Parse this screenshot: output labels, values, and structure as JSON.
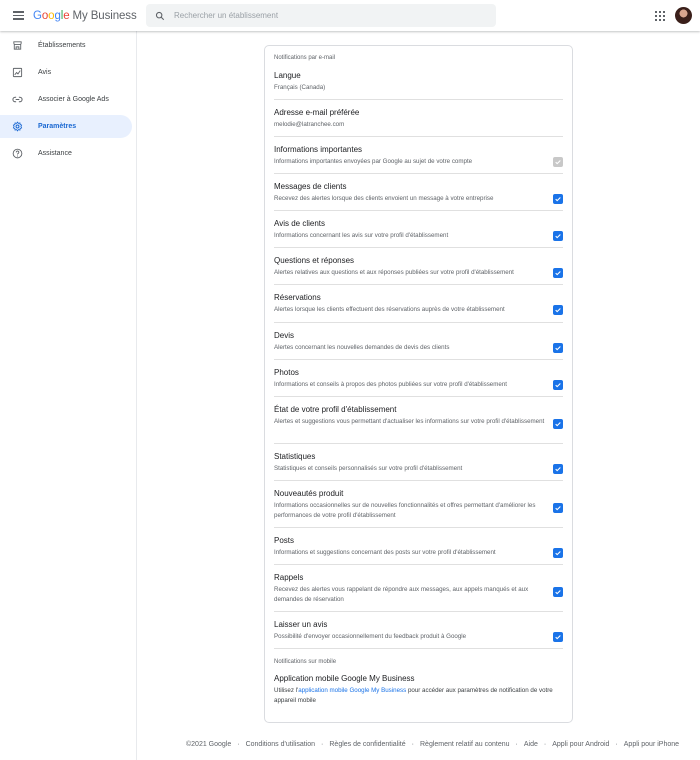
{
  "header": {
    "logo": {
      "g1": "G",
      "g2": "o",
      "g3": "o",
      "g4": "g",
      "g5": "l",
      "g6": "e",
      "product": "My Business"
    },
    "search_placeholder": "Rechercher un établissement"
  },
  "sidebar": {
    "items": [
      {
        "label": "Établissements",
        "icon": "storefront-icon"
      },
      {
        "label": "Avis",
        "icon": "review-icon"
      },
      {
        "label": "Associer à Google Ads",
        "icon": "link-icon"
      },
      {
        "label": "Paramètres",
        "icon": "gear-icon",
        "active": true
      },
      {
        "label": "Assistance",
        "icon": "help-icon"
      }
    ]
  },
  "card": {
    "email_section_title": "Notifications par e-mail",
    "language": {
      "title": "Langue",
      "value": "Français (Canada)"
    },
    "email": {
      "title": "Adresse e-mail préférée",
      "value": "melodie@latranchee.com"
    },
    "settings": [
      {
        "title": "Informations importantes",
        "desc": "Informations importantes envoyées par Google au sujet de votre compte",
        "checked": true,
        "disabled": true
      },
      {
        "title": "Messages de clients",
        "desc": "Recevez des alertes lorsque des clients envoient un message à votre entreprise",
        "checked": true
      },
      {
        "title": "Avis de clients",
        "desc": "Informations concernant les avis sur votre profil d'établissement",
        "checked": true
      },
      {
        "title": "Questions et réponses",
        "desc": "Alertes relatives aux questions et aux réponses publiées sur votre profil d'établissement",
        "checked": true
      },
      {
        "title": "Réservations",
        "desc": "Alertes lorsque les clients effectuent des réservations auprès de votre établissement",
        "checked": true
      },
      {
        "title": "Devis",
        "desc": "Alertes concernant les nouvelles demandes de devis des clients",
        "checked": true
      },
      {
        "title": "Photos",
        "desc": "Informations et conseils à propos des photos publiées sur votre profil d'établissement",
        "checked": true
      },
      {
        "title": "État de votre profil d'établissement",
        "desc": "Alertes et suggestions vous permettant d'actualiser les informations sur votre profil d'établissement",
        "checked": true
      },
      {
        "title": "Statistiques",
        "desc": "Statistiques et conseils personnalisés sur votre profil d'établissement",
        "checked": true
      },
      {
        "title": "Nouveautés produit",
        "desc": "Informations occasionnelles sur de nouvelles fonctionnalités et offres permettant d'améliorer les performances de votre profil d'établissement",
        "checked": true
      },
      {
        "title": "Posts",
        "desc": "Informations et suggestions concernant des posts sur votre profil d'établissement",
        "checked": true
      },
      {
        "title": "Rappels",
        "desc": "Recevez des alertes vous rappelant de répondre aux messages, aux appels manqués et aux demandes de réservation",
        "checked": true
      },
      {
        "title": "Laisser un avis",
        "desc": "Possibilité d'envoyer occasionnellement du feedback produit à Google",
        "checked": true
      }
    ],
    "mobile_section_title": "Notifications sur mobile",
    "mobile": {
      "title": "Application mobile Google My Business",
      "desc_before": "Utilisez l'",
      "link": "application mobile Google My Business",
      "desc_after": " pour accéder aux paramètres de notification de votre appareil mobile"
    }
  },
  "footer": {
    "links": [
      "©2021 Google",
      "Conditions d'utilisation",
      "Règles de confidentialité",
      "Règlement relatif au contenu",
      "Aide",
      "Appli pour Android",
      "Appli pour iPhone"
    ],
    "separator": "·"
  },
  "colors": {
    "accent": "#1a73e8",
    "active_bg": "#e8f0fe",
    "active_text": "#1967d2"
  }
}
